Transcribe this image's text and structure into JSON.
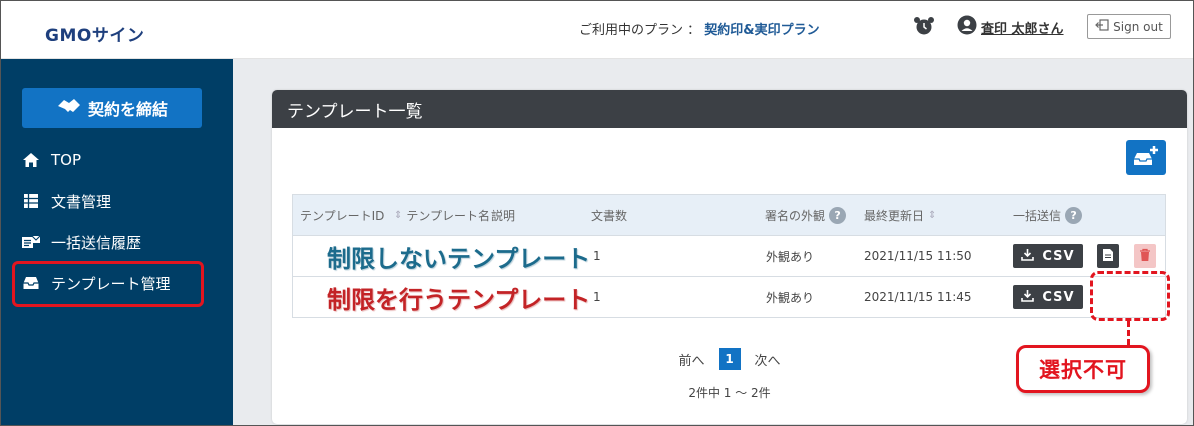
{
  "header": {
    "logo": "GMOサイン",
    "plan_label": "ご利用中のプラン ：",
    "plan_name": "契約印&実印プラン",
    "user_name": "査印 太郎さん",
    "signout_label": "Sign out"
  },
  "sidebar": {
    "sign_button": "契約を締結",
    "items": [
      {
        "label": "TOP",
        "icon": "home-icon"
      },
      {
        "label": "文書管理",
        "icon": "table-icon"
      },
      {
        "label": "一括送信履歴",
        "icon": "bulk-send-icon"
      },
      {
        "label": "テンプレート管理",
        "icon": "inbox-icon"
      }
    ]
  },
  "main": {
    "card_title": "テンプレート一覧",
    "table": {
      "headers": {
        "template_id": "テンプレートID",
        "template_name": "テンプレート名",
        "description": "説明",
        "doc_count": "文書数",
        "appearance": "署名の外観",
        "updated": "最終更新日",
        "bulk_send": "一括送信"
      },
      "rows": [
        {
          "name": "制限しないテンプレート",
          "doc_count": "1",
          "appearance": "外観あり",
          "updated": "2021/11/15 11:50",
          "csv": "CSV"
        },
        {
          "name": "制限を行うテンプレート",
          "doc_count": "1",
          "appearance": "外観あり",
          "updated": "2021/11/15 11:45",
          "csv": "CSV"
        }
      ]
    },
    "pager": {
      "prev": "前へ",
      "current": "1",
      "next": "次へ"
    },
    "count_text": "2件中 1 ～ 2件"
  },
  "annotation": {
    "callout": "選択不可"
  },
  "colors": {
    "accent": "#1273c4",
    "sidebar": "#003e66",
    "highlight_red": "#e2151f"
  }
}
